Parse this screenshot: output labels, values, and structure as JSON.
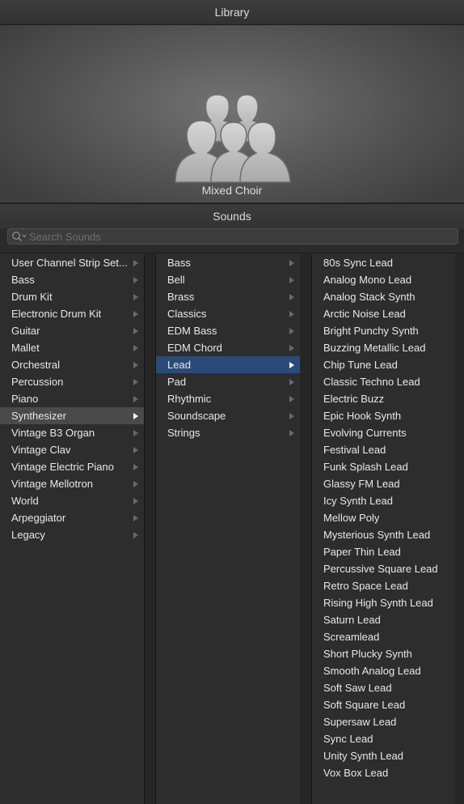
{
  "library": {
    "title": "Library",
    "instrument_name": "Mixed Choir",
    "instrument_icon": "mixed-choir-icon"
  },
  "sounds": {
    "title": "Sounds",
    "search_placeholder": "Search Sounds",
    "search_value": ""
  },
  "categories": [
    {
      "label": "User Channel Strip Set...",
      "selected": false
    },
    {
      "label": "Bass",
      "selected": false
    },
    {
      "label": "Drum Kit",
      "selected": false
    },
    {
      "label": "Electronic Drum Kit",
      "selected": false
    },
    {
      "label": "Guitar",
      "selected": false
    },
    {
      "label": "Mallet",
      "selected": false
    },
    {
      "label": "Orchestral",
      "selected": false
    },
    {
      "label": "Percussion",
      "selected": false
    },
    {
      "label": "Piano",
      "selected": false
    },
    {
      "label": "Synthesizer",
      "selected": true
    },
    {
      "label": "Vintage B3 Organ",
      "selected": false
    },
    {
      "label": "Vintage Clav",
      "selected": false
    },
    {
      "label": "Vintage Electric Piano",
      "selected": false
    },
    {
      "label": "Vintage Mellotron",
      "selected": false
    },
    {
      "label": "World",
      "selected": false
    },
    {
      "label": "Arpeggiator",
      "selected": false
    },
    {
      "label": "Legacy",
      "selected": false
    }
  ],
  "subcategories": [
    {
      "label": "Bass",
      "selected": false
    },
    {
      "label": "Bell",
      "selected": false
    },
    {
      "label": "Brass",
      "selected": false
    },
    {
      "label": "Classics",
      "selected": false
    },
    {
      "label": "EDM Bass",
      "selected": false
    },
    {
      "label": "EDM Chord",
      "selected": false
    },
    {
      "label": "Lead",
      "selected": true
    },
    {
      "label": "Pad",
      "selected": false
    },
    {
      "label": "Rhythmic",
      "selected": false
    },
    {
      "label": "Soundscape",
      "selected": false
    },
    {
      "label": "Strings",
      "selected": false
    }
  ],
  "patches": [
    "80s Sync Lead",
    "Analog Mono Lead",
    "Analog Stack Synth",
    "Arctic Noise Lead",
    "Bright Punchy Synth",
    "Buzzing Metallic Lead",
    "Chip Tune Lead",
    "Classic Techno Lead",
    "Electric Buzz",
    "Epic Hook Synth",
    "Evolving Currents",
    "Festival Lead",
    "Funk Splash Lead",
    "Glassy FM Lead",
    "Icy Synth Lead",
    "Mellow Poly",
    "Mysterious Synth Lead",
    "Paper Thin Lead",
    "Percussive Square Lead",
    "Retro Space Lead",
    "Rising High Synth Lead",
    "Saturn Lead",
    "Screamlead",
    "Short Plucky Synth",
    "Smooth Analog Lead",
    "Soft Saw Lead",
    "Soft Square Lead",
    "Supersaw Lead",
    "Sync Lead",
    "Unity Synth Lead",
    "Vox Box Lead"
  ],
  "colors": {
    "selection_active": "#2c4a78",
    "selection_inactive": "#4a4a4a",
    "panel_background": "#2d2d2d"
  }
}
